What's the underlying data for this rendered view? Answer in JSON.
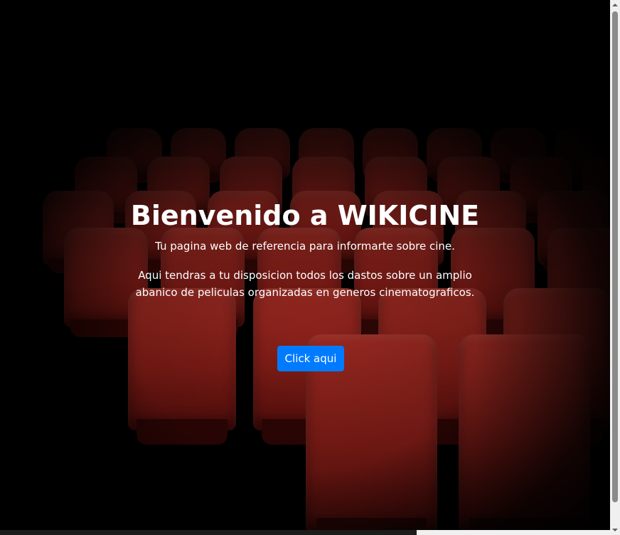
{
  "hero": {
    "title": "Bienvenido a WIKICINE",
    "lead": "Tu pagina web de referencia para informarte sobre cine.",
    "description": "Aqui tendras a tu disposicion todos los dastos sobre un amplio abanico de peliculas organizadas en generos cinematograficos.",
    "button_label": "Click aqui"
  },
  "colors": {
    "accent": "#007bff",
    "background": "#000000",
    "seat": "#b02a22"
  },
  "background_image": "cinema-seats-image"
}
